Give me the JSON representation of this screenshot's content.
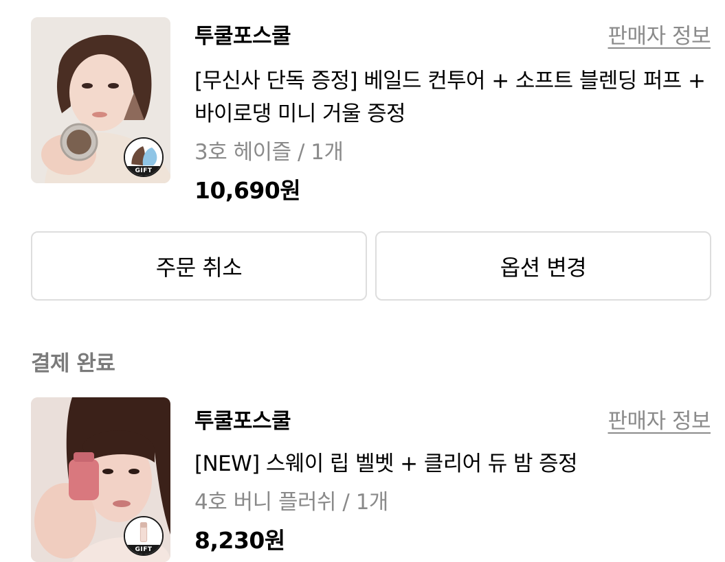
{
  "orders": [
    {
      "brand": "투쿨포스쿨",
      "seller_info_label": "판매자 정보",
      "product_name": "[무신사 단독 증정] 베일드 컨투어 + 소프트 블렌딩 퍼프 + 바이로댕 미니 거울 증정",
      "option": "3호 헤이즐 / 1개",
      "price": "10,690원",
      "gift_badge_label": "GIFT",
      "thumbnail_icon": "model-holding-contour-compact-image"
    },
    {
      "brand": "투쿨포스쿨",
      "seller_info_label": "판매자 정보",
      "product_name": "[NEW] 스웨이 립 벨벳 + 클리어 듀 밤 증정",
      "option": "4호 버니 플러쉬 / 1개",
      "price": "8,230원",
      "gift_badge_label": "GIFT",
      "thumbnail_icon": "model-holding-lip-tint-image"
    }
  ],
  "actions": {
    "cancel_order_label": "주문 취소",
    "change_option_label": "옵션 변경"
  },
  "section": {
    "payment_complete_title": "결제 완료"
  },
  "colors": {
    "text_primary": "#000000",
    "text_secondary": "#8a8a8a",
    "section_title": "#7a7a7a",
    "button_border": "#dddddd",
    "gift_badge": "#1a1a1a"
  }
}
